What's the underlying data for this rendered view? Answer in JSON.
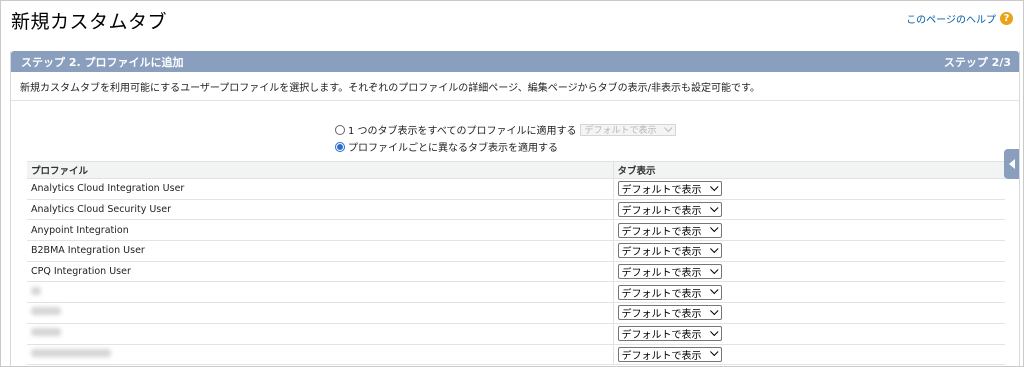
{
  "page": {
    "title": "新規カスタムタブ",
    "help_label": "このページのヘルプ",
    "help_icon": "?"
  },
  "panel": {
    "step_title": "ステップ 2. プロファイルに追加",
    "step_counter": "ステップ 2/3",
    "description": "新規カスタムタブを利用可能にするユーザープロファイルを選択します。それぞれのプロファイルの詳細ページ、編集ページからタブの表示/非表示も設定可能です。"
  },
  "options": {
    "apply_all_label": "1 つのタブ表示をすべてのプロファイルに適用する",
    "apply_all_select": "デフォルトで表示",
    "apply_each_label": "プロファイルごとに異なるタブ表示を適用する",
    "selected": "apply_each"
  },
  "table": {
    "headers": [
      "プロファイル",
      "タブ表示"
    ],
    "rows": [
      {
        "profile": "Analytics Cloud Integration User",
        "visibility": "デフォルトで表示"
      },
      {
        "profile": "Analytics Cloud Security User",
        "visibility": "デフォルトで表示"
      },
      {
        "profile": "Anypoint Integration",
        "visibility": "デフォルトで表示"
      },
      {
        "profile": "B2BMA Integration User",
        "visibility": "デフォルトで表示"
      },
      {
        "profile": "CPQ Integration User",
        "visibility": "デフォルトで表示"
      },
      {
        "profile": "",
        "visibility": "デフォルトで表示"
      },
      {
        "profile": "",
        "visibility": "デフォルトで表示"
      },
      {
        "profile": "",
        "visibility": "デフォルトで表示"
      },
      {
        "profile": "",
        "visibility": "デフォルトで表示"
      }
    ]
  },
  "colors": {
    "header_bar": "#8a9ebe",
    "link": "#015ba7",
    "help_icon": "#e8a317"
  }
}
